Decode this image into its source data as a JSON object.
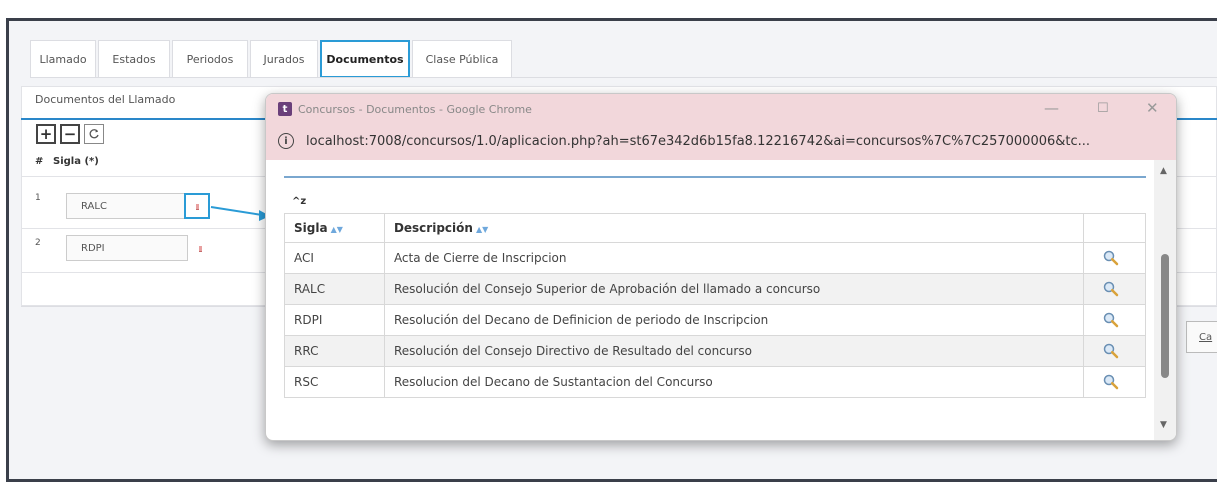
{
  "tabs": [
    {
      "label": "Llamado"
    },
    {
      "label": "Estados"
    },
    {
      "label": "Periodos"
    },
    {
      "label": "Jurados"
    },
    {
      "label": "Documentos"
    },
    {
      "label": "Clase Pública"
    }
  ],
  "panel": {
    "title": "Documentos del Llamado",
    "col_hash": "#",
    "col_sigla": "Sigla (*)",
    "rows": [
      {
        "num": "1",
        "value": "RALC"
      },
      {
        "num": "2",
        "value": "RDPI"
      }
    ],
    "cancel_label": "Ca"
  },
  "popup": {
    "title": "Concursos - Documentos - Google Chrome",
    "url": "localhost:7008/concursos/1.0/aplicacion.php?ah=st67e342d6b15fa8.12216742&ai=concursos%7C%7C257000006&tc...",
    "az_label": "^z",
    "headers": {
      "sigla": "Sigla",
      "descripcion": "Descripción"
    },
    "rows": [
      {
        "sigla": "ACI",
        "descripcion": "Acta de Cierre de Inscripcion"
      },
      {
        "sigla": "RALC",
        "descripcion": "Resolución del Consejo Superior de Aprobación del llamado a concurso"
      },
      {
        "sigla": "RDPI",
        "descripcion": "Resolución del Decano de Definicion de periodo de Inscripcion"
      },
      {
        "sigla": "RRC",
        "descripcion": "Resolución del Consejo Directivo de Resultado del concurso"
      },
      {
        "sigla": "RSC",
        "descripcion": "Resolucion del Decano de Sustantacion del Concurso"
      }
    ]
  },
  "colors": {
    "accent": "#2a9bd6",
    "titlebar": "#f2d7db",
    "frame": "#3a3f4a"
  }
}
